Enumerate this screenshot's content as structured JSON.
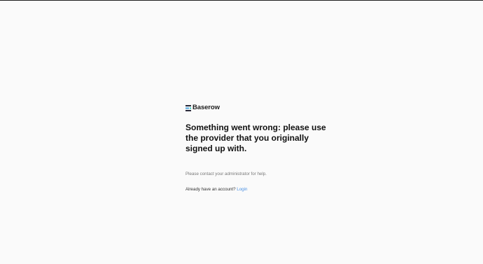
{
  "brand": {
    "name": "Baserow",
    "logo_icon": "baserow-logo-icon",
    "colors": {
      "bar_dark": "#2a2a3a",
      "bar_blue": "#4aa3df",
      "bar_teal": "#26c6b8"
    }
  },
  "error": {
    "title": "Something went wrong: please use the provider that you originally signed up with.",
    "help_text": "Please contact your administrator for help."
  },
  "login": {
    "prompt": "Already have an account?",
    "link_label": "Login",
    "link_color": "#4a90e2"
  }
}
